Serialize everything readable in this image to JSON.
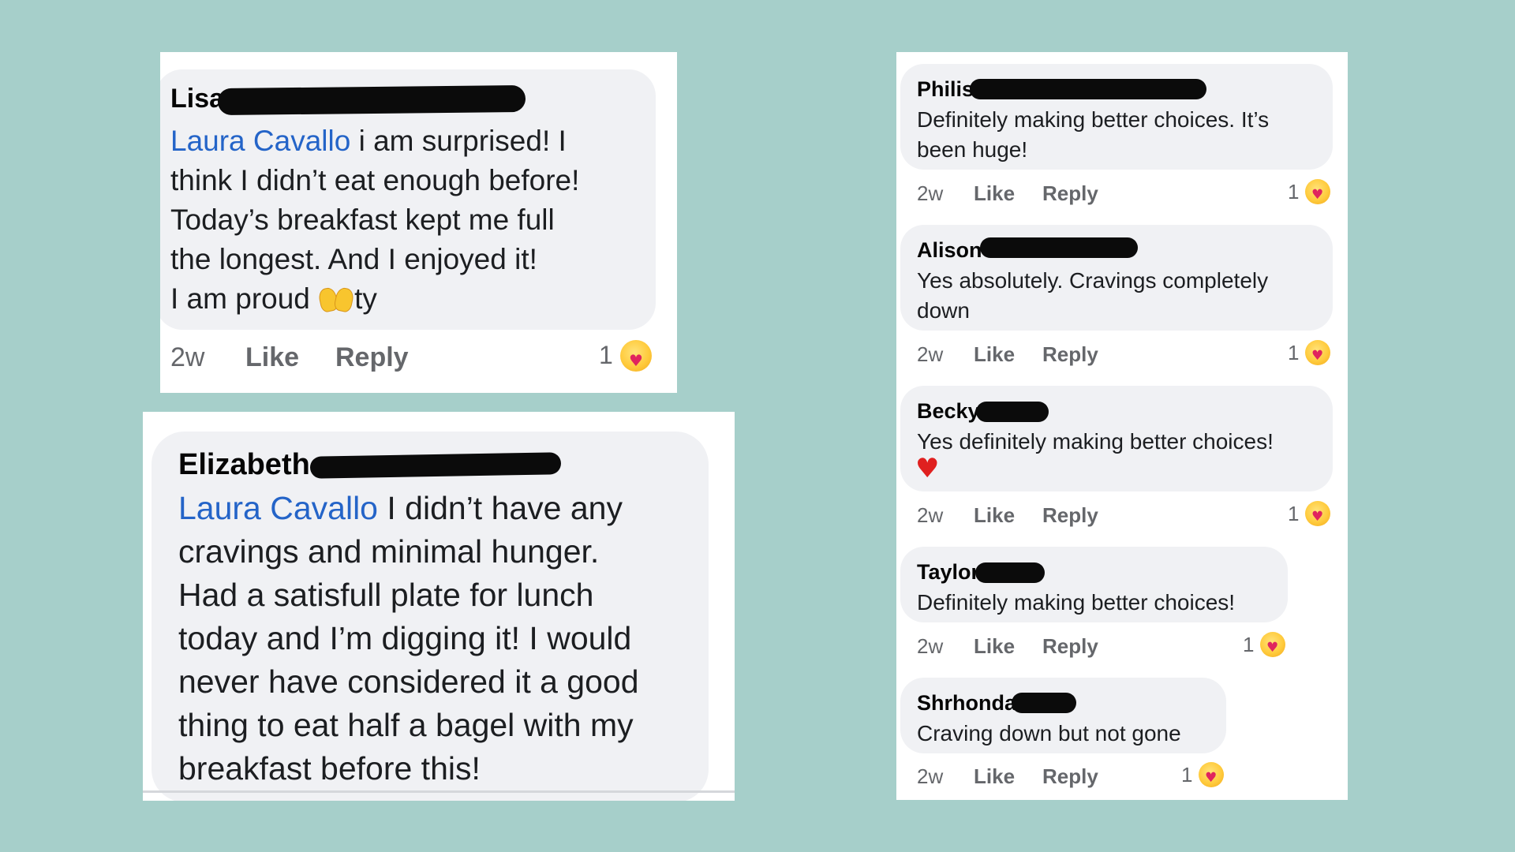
{
  "colors": {
    "background": "#a6cfca",
    "bubble": "#f0f1f4",
    "mention": "#2464c8",
    "meta": "#65676b"
  },
  "comments": [
    {
      "name": "Lisa",
      "mention": "Laura Cavallo",
      "text": " i am surprised! I\nthink I didn’t eat enough before!\nToday’s breakfast kept me full\nthe longest. And I enjoyed it!\nI am proud ",
      "text_end": "ty",
      "emoji": "raising-hands-icon",
      "time": "2w",
      "like": "Like",
      "reply": "Reply",
      "reaction_count": "1",
      "reaction": "care-reaction-icon"
    },
    {
      "name": "Elizabeth",
      "mention": "Laura Cavallo",
      "text": " I didn’t have any\ncravings and minimal hunger.\nHad a satisfull plate for lunch\ntoday and I’m digging it! I would\nnever have considered it a good\nthing to eat half a bagel with my\nbreakfast before this!"
    },
    {
      "name": "Philis",
      "text": "Definitely making better choices. It’s\nbeen huge!",
      "time": "2w",
      "like": "Like",
      "reply": "Reply",
      "reaction_count": "1",
      "reaction": "care-reaction-icon"
    },
    {
      "name": "Alison",
      "text": "Yes absolutely. Cravings completely\ndown",
      "time": "2w",
      "like": "Like",
      "reply": "Reply",
      "reaction_count": "1",
      "reaction": "care-reaction-icon"
    },
    {
      "name": "Becky",
      "text": "Yes definitely making better choices!",
      "emoji": "red-heart-icon",
      "time": "2w",
      "like": "Like",
      "reply": "Reply",
      "reaction_count": "1",
      "reaction": "care-reaction-icon"
    },
    {
      "name": "Taylor",
      "text": "Definitely making better choices!",
      "time": "2w",
      "like": "Like",
      "reply": "Reply",
      "reaction_count": "1",
      "reaction": "care-reaction-icon"
    },
    {
      "name": "Shrhonda",
      "text": "Craving down but not gone",
      "time": "2w",
      "like": "Like",
      "reply": "Reply",
      "reaction_count": "1",
      "reaction": "care-reaction-icon"
    }
  ]
}
